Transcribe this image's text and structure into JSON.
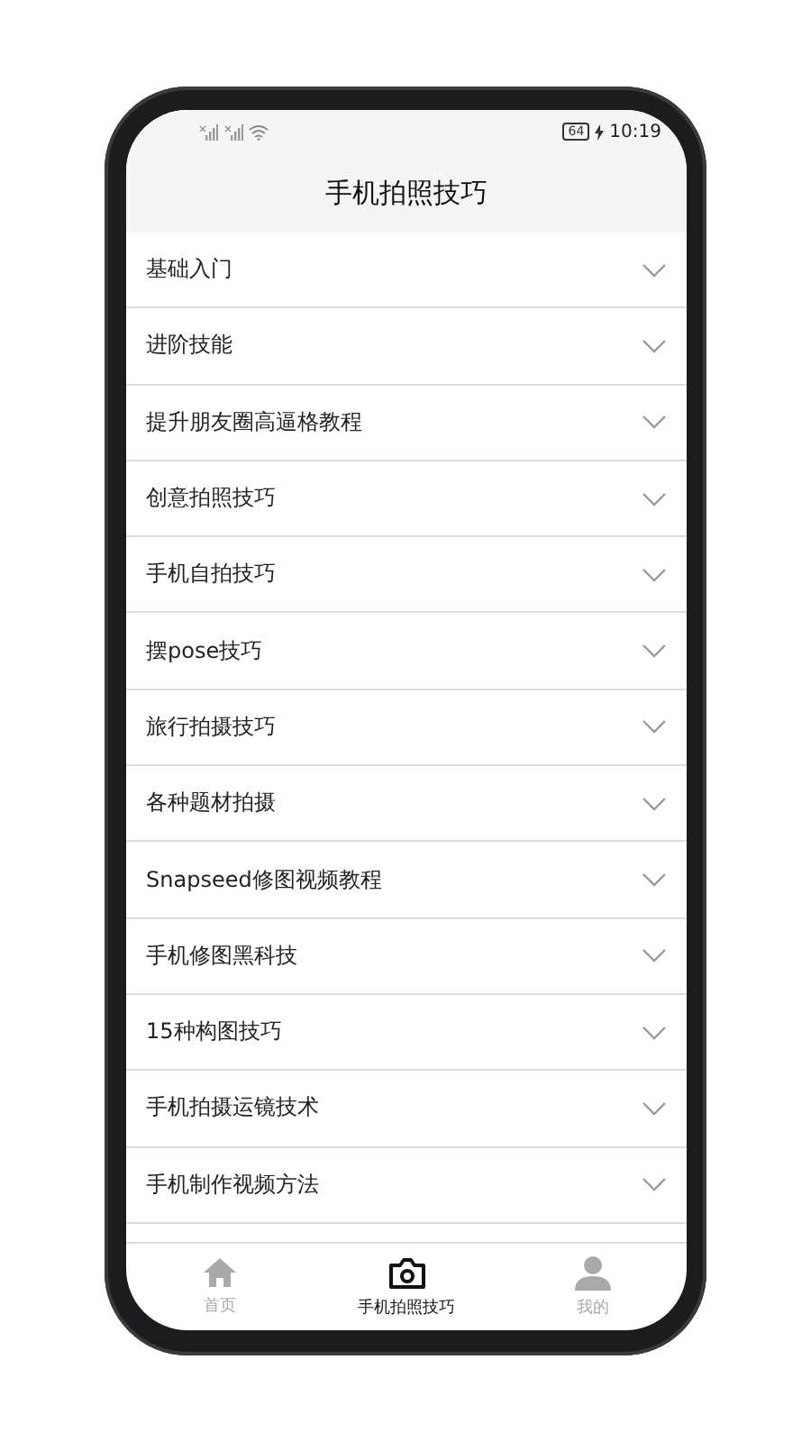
{
  "status_bar": {
    "battery": "64",
    "time": "10:19"
  },
  "header": {
    "title": "手机拍照技巧"
  },
  "list": [
    {
      "label": "基础入门",
      "expanded": false
    },
    {
      "label": "进阶技能",
      "expanded": false
    },
    {
      "label": "提升朋友圈高逼格教程",
      "expanded": false
    },
    {
      "label": "创意拍照技巧",
      "expanded": false
    },
    {
      "label": "手机自拍技巧",
      "expanded": false
    },
    {
      "label": "摆pose技巧",
      "expanded": false
    },
    {
      "label": "旅行拍摄技巧",
      "expanded": false
    },
    {
      "label": "各种题材拍摄",
      "expanded": false
    },
    {
      "label": "Snapseed修图视频教程",
      "expanded": false
    },
    {
      "label": "手机修图黑科技",
      "expanded": false
    },
    {
      "label": "15种构图技巧",
      "expanded": false
    },
    {
      "label": "手机拍摄运镜技术",
      "expanded": false
    },
    {
      "label": "手机制作视频方法",
      "expanded": false
    }
  ],
  "tab_bar": [
    {
      "label": "首页",
      "kind": "home",
      "selected": false
    },
    {
      "label": "手机拍照技巧",
      "kind": "camera",
      "selected": true
    },
    {
      "label": "我的",
      "kind": "person",
      "selected": false
    }
  ]
}
